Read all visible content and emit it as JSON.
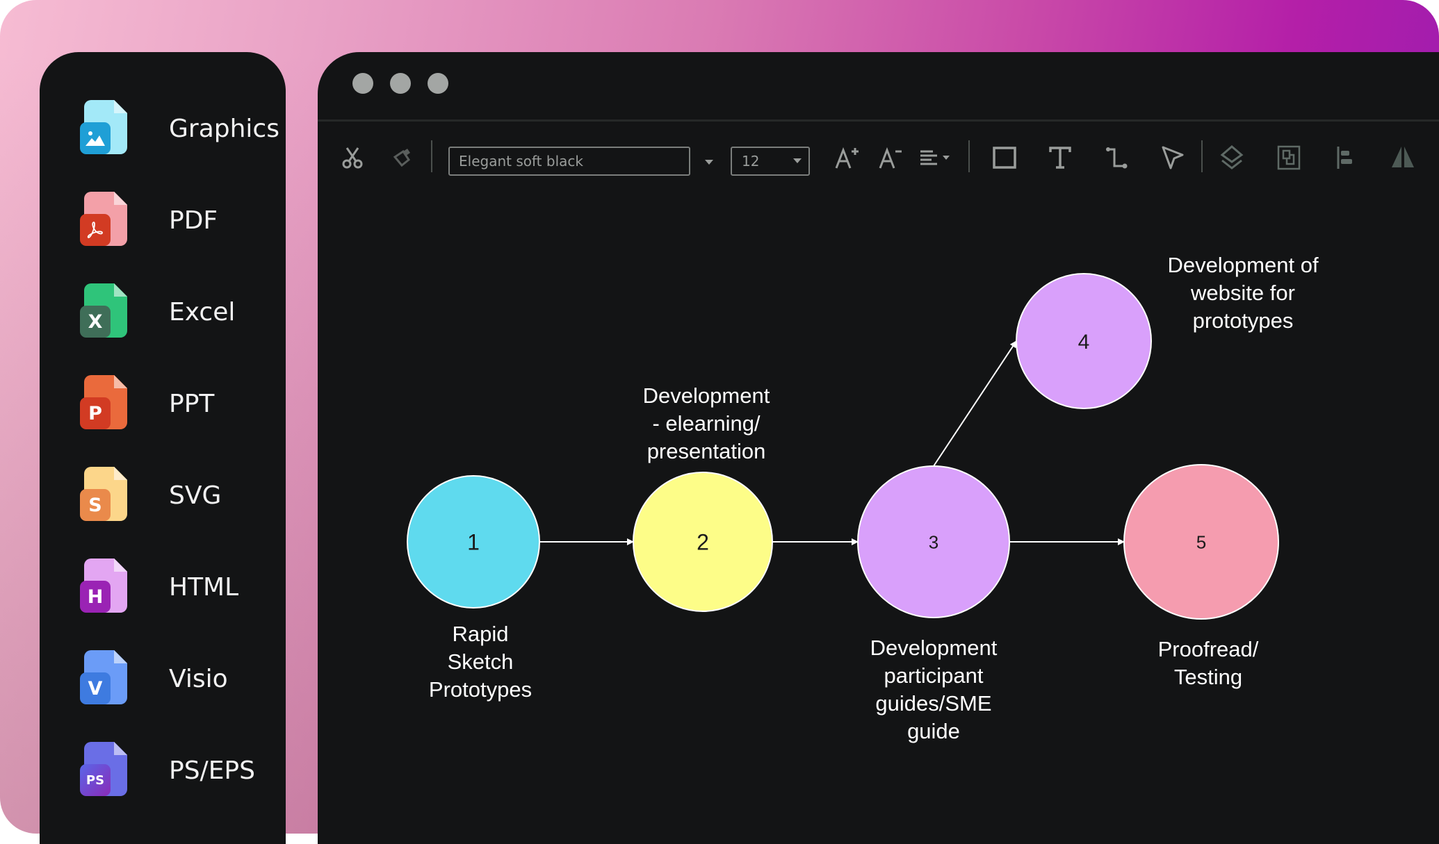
{
  "sidebar": {
    "items": [
      {
        "label": "Graphics",
        "icon": "graphics-file-icon",
        "glyph": "",
        "back": "#a3e9f8",
        "front": "#1f9fd6"
      },
      {
        "label": "PDF",
        "icon": "pdf-file-icon",
        "glyph": "",
        "back": "#f3a0a8",
        "front": "#d23b23"
      },
      {
        "label": "Excel",
        "icon": "excel-file-icon",
        "glyph": "X",
        "back": "#2fc47a",
        "front": "#3f6e58"
      },
      {
        "label": "PPT",
        "icon": "ppt-file-icon",
        "glyph": "P",
        "back": "#ea6a3c",
        "front": "#d23b23"
      },
      {
        "label": "SVG",
        "icon": "svg-file-icon",
        "glyph": "S",
        "back": "#fcd68a",
        "front": "#ea8a4b"
      },
      {
        "label": "HTML",
        "icon": "html-file-icon",
        "glyph": "H",
        "back": "#e3a6f2",
        "front": "#9a23b4"
      },
      {
        "label": "Visio",
        "icon": "visio-file-icon",
        "glyph": "V",
        "back": "#6b9cf7",
        "front": "#3e7be0"
      },
      {
        "label": "PS/EPS",
        "icon": "ps-eps-file-icon",
        "glyph": "PS",
        "back": "#6a6ee6",
        "front": "#5452d6"
      }
    ]
  },
  "window": {
    "traffic_lights": [
      "close",
      "minimize",
      "maximize"
    ]
  },
  "toolbar": {
    "font_name": "Elegant soft black",
    "font_size": "12",
    "tools": [
      "cut-icon",
      "format-painter-icon",
      "increase-font-icon",
      "decrease-font-icon",
      "align-icon",
      "rectangle-icon",
      "text-icon",
      "connector-icon",
      "pointer-icon",
      "layers-icon",
      "group-icon",
      "align-left-icon",
      "flip-icon"
    ]
  },
  "diagram": {
    "nodes": [
      {
        "id": "1",
        "label": "Rapid\nSketch\nPrototypes",
        "color": "#5fdaee"
      },
      {
        "id": "2",
        "label": "Development\n- elearning/\npresentation",
        "color": "#fdfd88"
      },
      {
        "id": "3",
        "label": "Development\nparticipant\nguides/SME\nguide",
        "color": "#d9a0fb"
      },
      {
        "id": "4",
        "label": "Development of\nwebsite for\nprototypes",
        "color": "#d9a0fb"
      },
      {
        "id": "5",
        "label": "Proofread/\nTesting",
        "color": "#f59caf"
      }
    ],
    "edges": [
      {
        "from": "1",
        "to": "2"
      },
      {
        "from": "2",
        "to": "3"
      },
      {
        "from": "3",
        "to": "4"
      },
      {
        "from": "3",
        "to": "5"
      }
    ]
  }
}
